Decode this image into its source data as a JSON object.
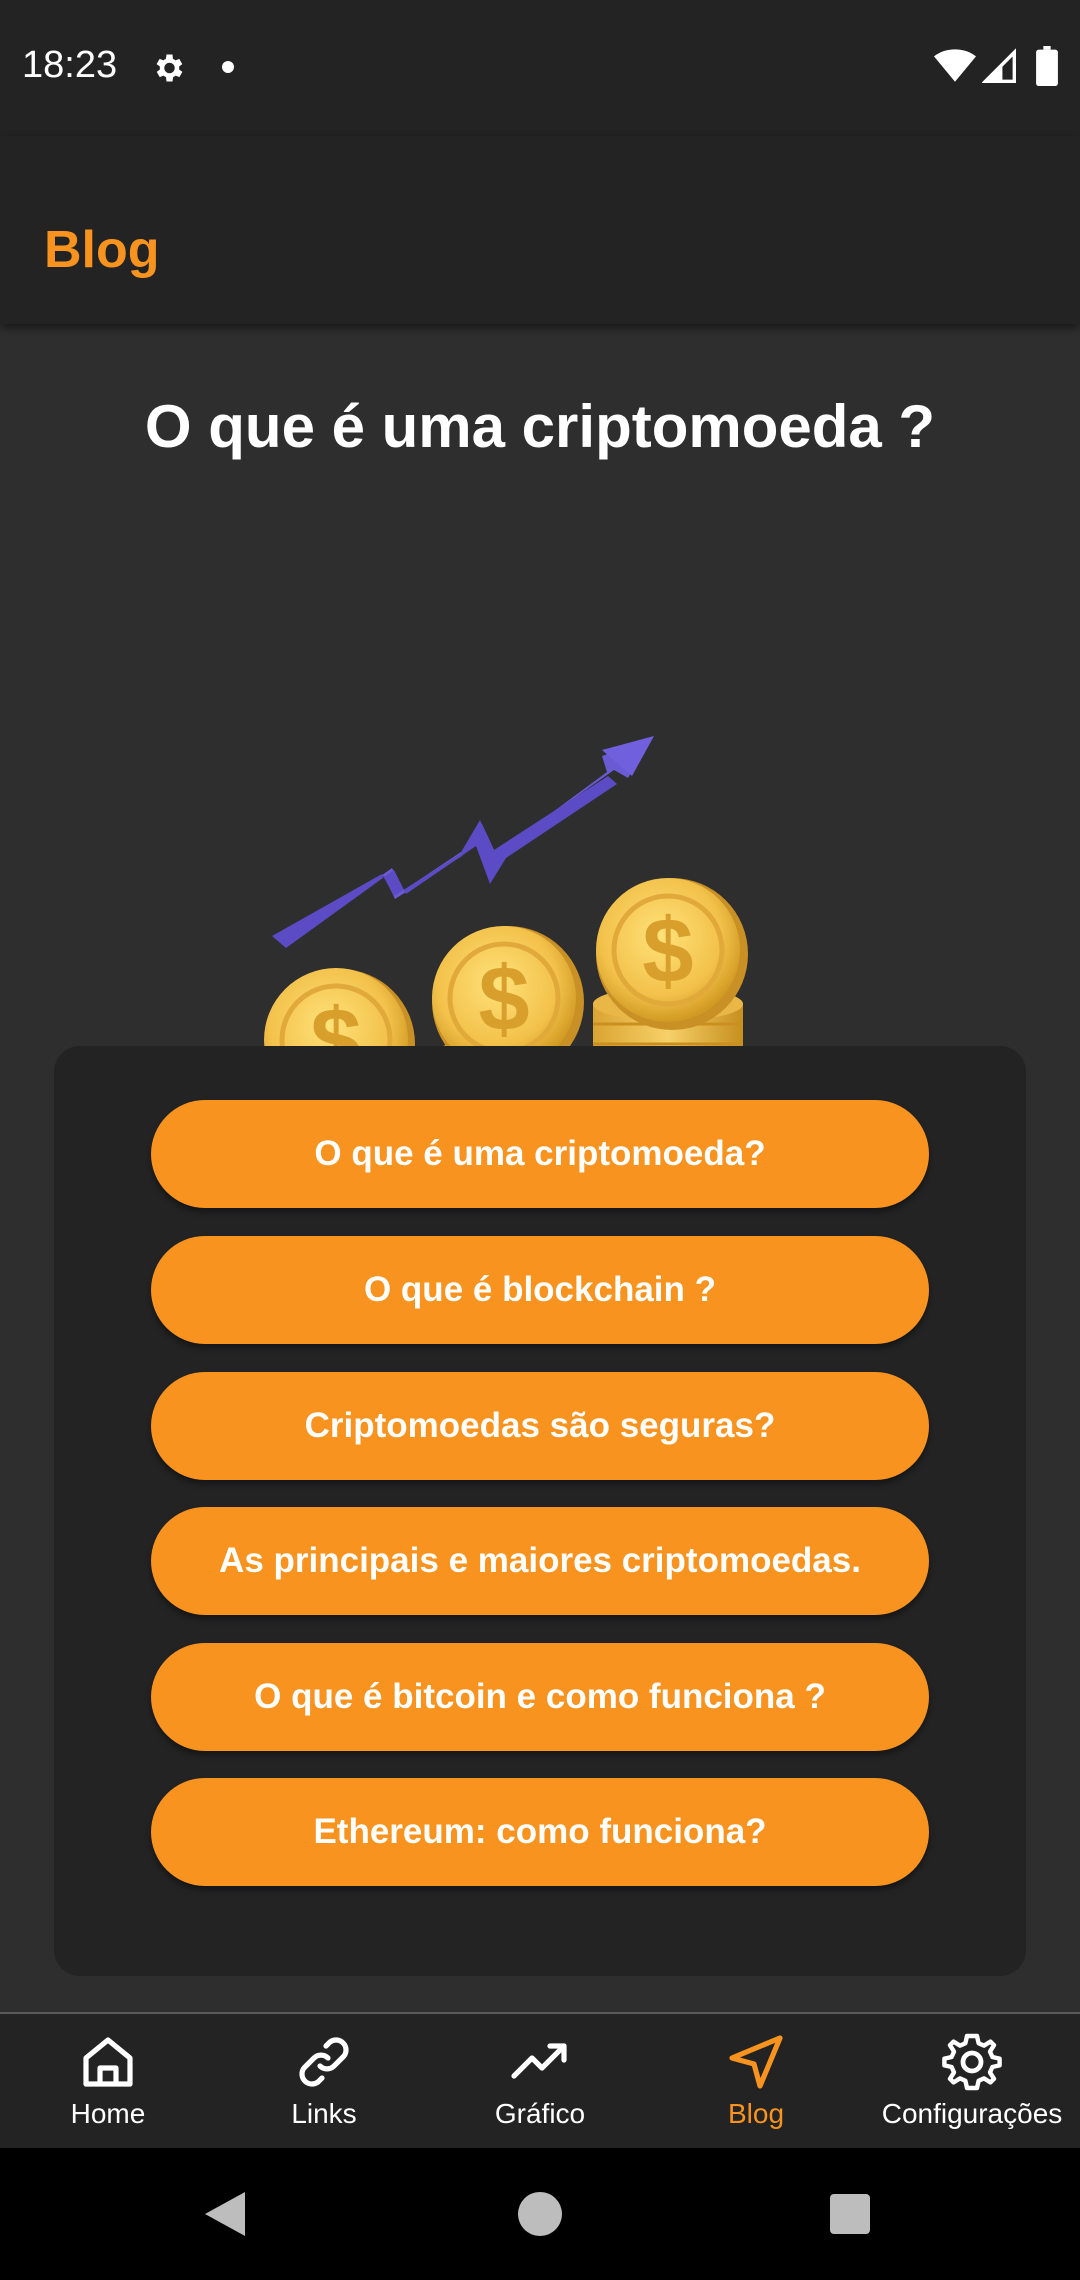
{
  "status_bar": {
    "time": "18:23",
    "icons": [
      "gear-icon",
      "notification-dot-icon",
      "wifi-icon",
      "signal-icon",
      "battery-icon"
    ]
  },
  "app_bar": {
    "title": "Blog"
  },
  "main": {
    "heading": "O que é uma criptomoeda ?",
    "illustration": "rising-arrow-gold-coins-illustration",
    "topics": [
      {
        "label": "O que é uma criptomoeda?"
      },
      {
        "label": "O que é blockchain ?"
      },
      {
        "label": "Criptomoedas são seguras?"
      },
      {
        "label": "As principais e maiores criptomoedas."
      },
      {
        "label": "O que é bitcoin e como funciona ?"
      },
      {
        "label": "Ethereum: como funciona?"
      }
    ]
  },
  "bottom_nav": {
    "items": [
      {
        "label": "Home",
        "icon": "home-icon"
      },
      {
        "label": "Links",
        "icon": "link-icon"
      },
      {
        "label": "Gráfico",
        "icon": "trending-up-icon"
      },
      {
        "label": "Blog",
        "icon": "navigation-arrow-icon",
        "active": true
      },
      {
        "label": "Configurações",
        "icon": "settings-gear-icon"
      }
    ]
  },
  "colors": {
    "accent": "#f7931e",
    "background": "#2e2e2f",
    "surface": "#232324",
    "text": "#ffffff"
  }
}
